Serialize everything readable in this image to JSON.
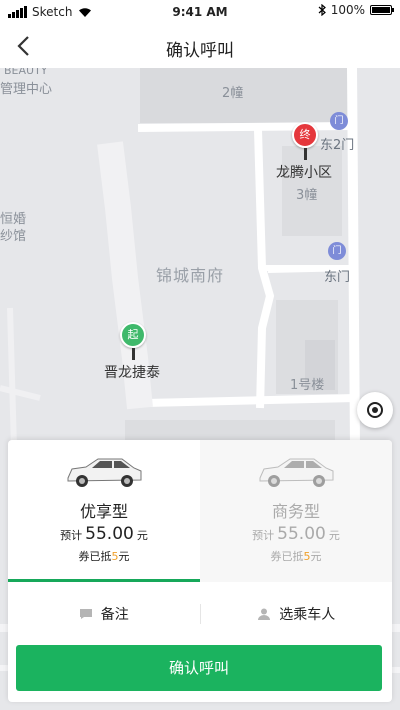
{
  "status_bar": {
    "carrier": "Sketch",
    "time": "9:41 AM",
    "battery": "100%",
    "battery_level": 1.0
  },
  "nav": {
    "back_icon": "chevron-left-icon",
    "title": "确认呼叫"
  },
  "map": {
    "labels": {
      "beauty": "BEAUTY",
      "management_center": "管理中心",
      "building_2": "2幢",
      "east_gate_2": "东2门",
      "longteng_community": "龙腾小区",
      "building_3": "3幢",
      "wedding_1": "恒婚",
      "wedding_2": "纱馆",
      "jincheng_nanfu": "锦城南府",
      "east_gate": "东门",
      "jinlong_jietai": "晋龙捷泰",
      "building_no1": "1号楼"
    },
    "pins": {
      "end": "终",
      "start": "起"
    },
    "gate_icon_glyph": "门",
    "colors": {
      "end_pin": "#e5373c",
      "start_pin": "#3fb96b",
      "gate_marker": "#7e8cd8"
    }
  },
  "car_options": [
    {
      "name": "优享型",
      "price_prefix": "预计",
      "price": "55.00",
      "price_unit": "元",
      "discount_prefix": "券已抵",
      "discount_amount": "5",
      "discount_unit": "元",
      "selected": true
    },
    {
      "name": "商务型",
      "price_prefix": "预计",
      "price": "55.00",
      "price_unit": "元",
      "discount_prefix": "券已抵",
      "discount_amount": "5",
      "discount_unit": "元",
      "selected": false
    }
  ],
  "options": {
    "note_label": "备注",
    "passenger_label": "选乘车人"
  },
  "confirm_button": {
    "label": "确认呼叫",
    "color": "#1bb35f"
  },
  "accent_color": "#16a85a"
}
